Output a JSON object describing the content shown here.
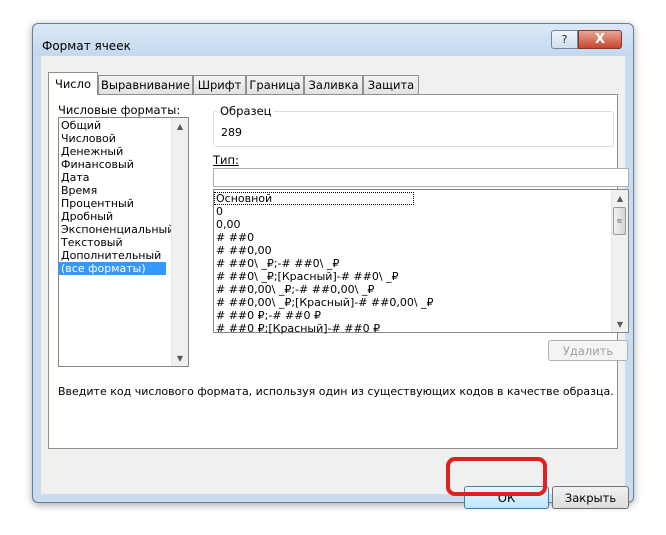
{
  "window": {
    "title": "Формат ячеек",
    "help_label": "?",
    "close_label": "X"
  },
  "tabs": [
    "Число",
    "Выравнивание",
    "Шрифт",
    "Граница",
    "Заливка",
    "Защита"
  ],
  "number_tab": {
    "formats_label": "Числовые форматы:",
    "categories": [
      "Общий",
      "Числовой",
      "Денежный",
      "Финансовый",
      "Дата",
      "Время",
      "Процентный",
      "Дробный",
      "Экспоненциальный",
      "Текстовый",
      "Дополнительный",
      "(все форматы)"
    ],
    "selected_category": "(все форматы)",
    "sample_label": "Образец",
    "sample_value": "289",
    "type_label": "Тип:",
    "type_value": "",
    "format_codes": [
      "Основной",
      "0",
      "0,00",
      "# ##0",
      "# ##0,00",
      "# ##0\\ _₽;-# ##0\\ _₽",
      "# ##0\\ _₽;[Красный]-# ##0\\ _₽",
      "# ##0,00\\ _₽;-# ##0,00\\ _₽",
      "# ##0,00\\ _₽;[Красный]-# ##0,00\\ _₽",
      "# ##0 ₽;-# ##0 ₽",
      "# ##0 ₽;[Красный]-# ##0 ₽"
    ],
    "delete_label": "Удалить",
    "hint": "Введите код числового формата, используя один из существующих кодов в качестве образца."
  },
  "footer": {
    "ok_label": "ОК",
    "close_label": "Закрыть"
  },
  "colors": {
    "selection": "#3399ff",
    "highlight": "#e02020",
    "titlebar": "#c9dcf0"
  }
}
